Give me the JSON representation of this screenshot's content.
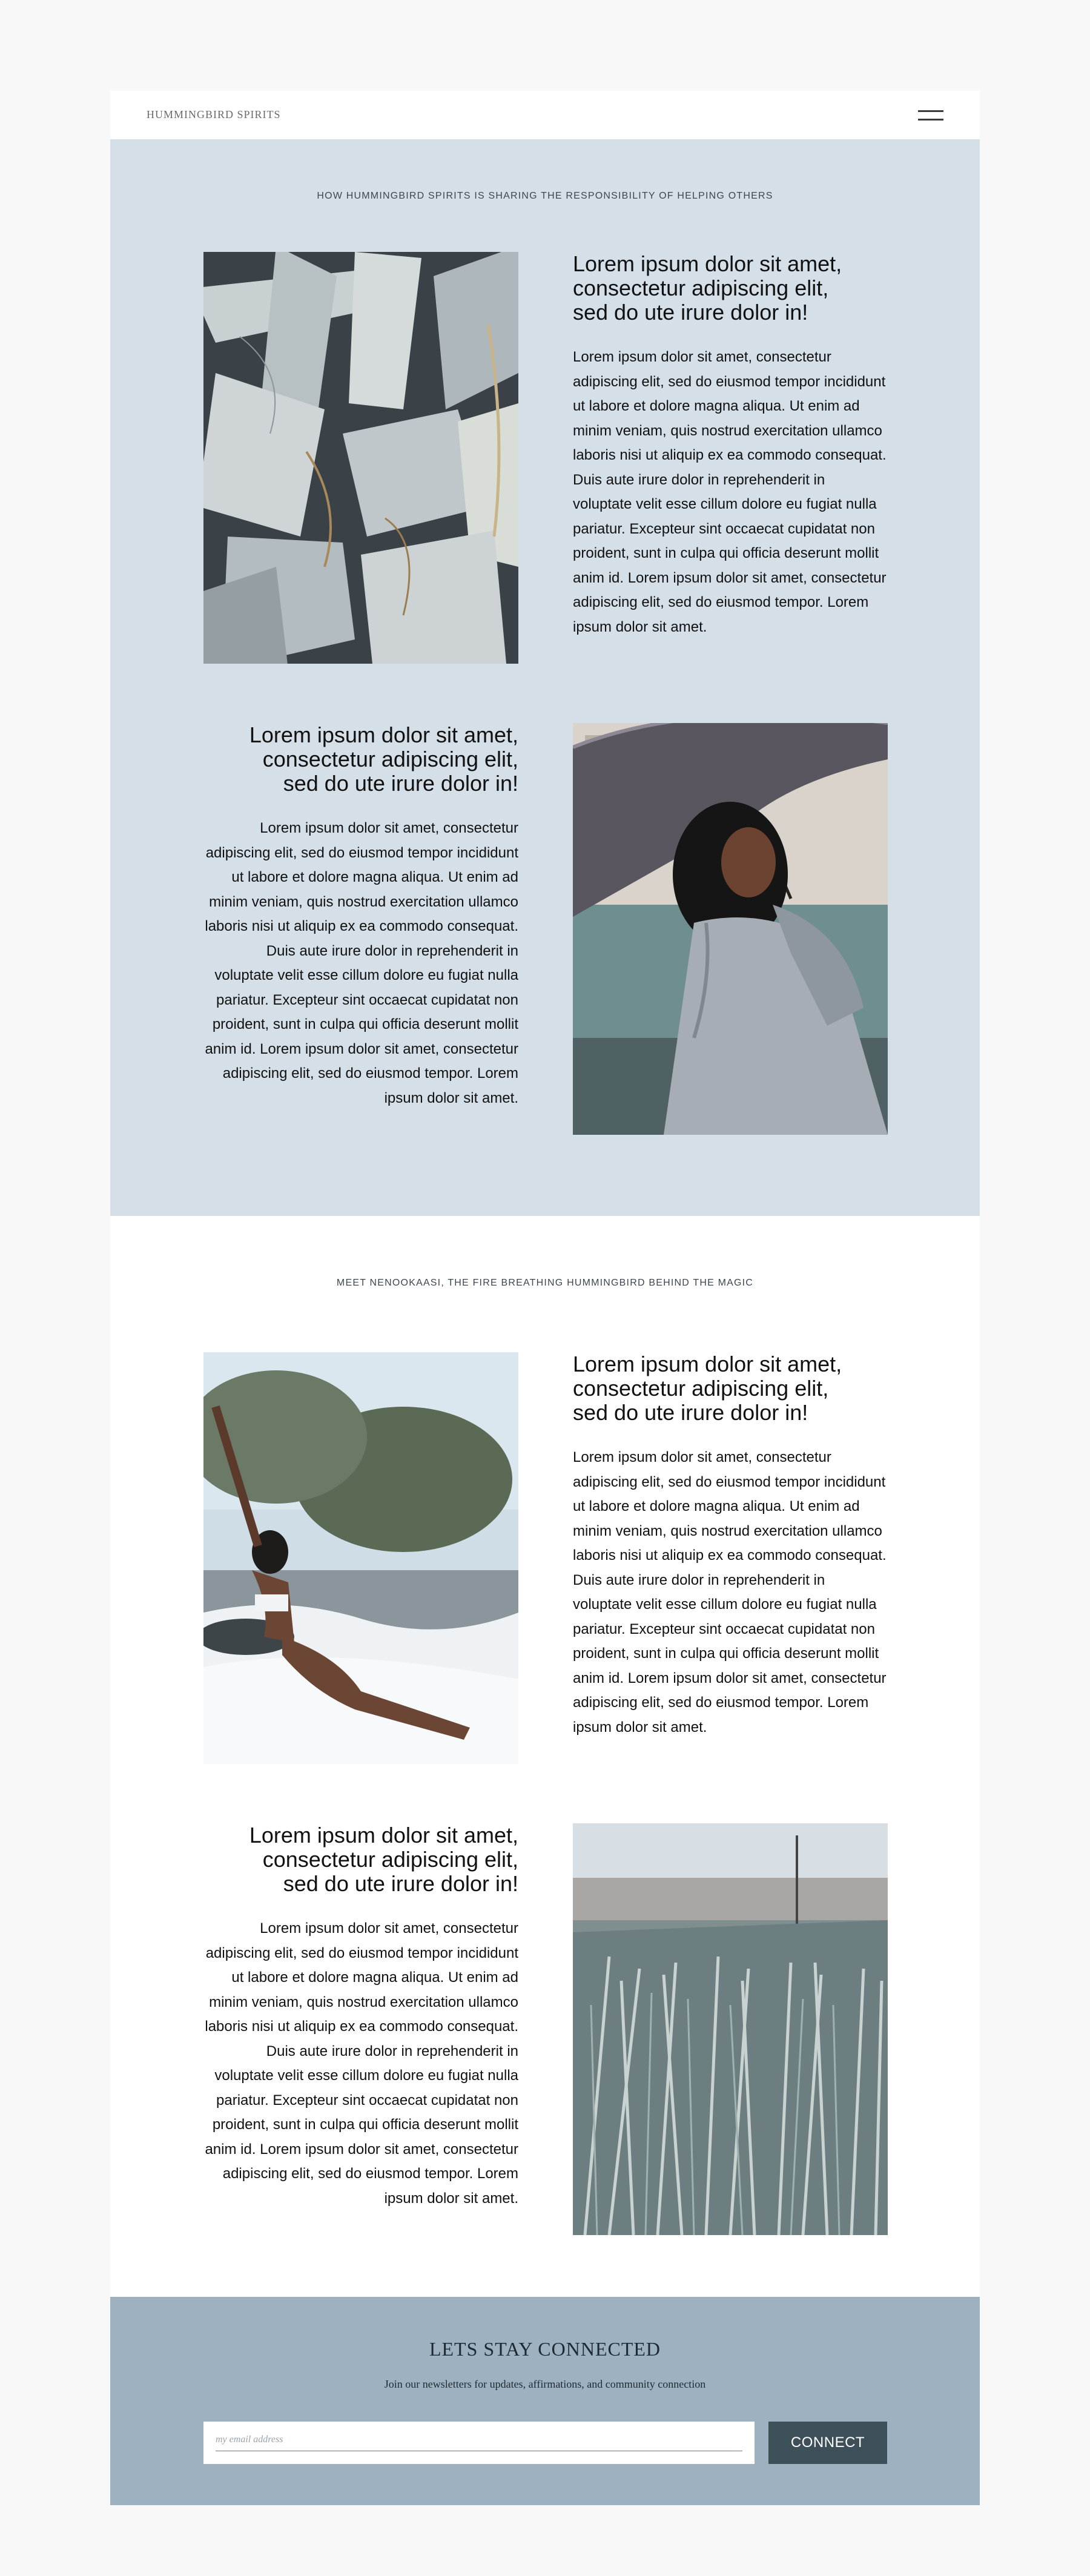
{
  "header": {
    "brand": "HUMMINGBIRD SPIRITS",
    "menu_icon": "hamburger-menu-icon"
  },
  "section1": {
    "label": "HOW HUMMINGBIRD SPIRITS IS SHARING THE RESPONSIBILITY OF HELPING OTHERS",
    "blocks": [
      {
        "title": "Lorem ipsum dolor sit amet,\nconsectetur adipiscing elit,\nsed do ute irure dolor in!",
        "body": "Lorem ipsum dolor sit amet, consectetur adipiscing elit, sed do eiusmod tempor incididunt ut labore et dolore magna aliqua. Ut enim ad minim veniam, quis nostrud exercitation ullamco laboris nisi ut aliquip ex ea commodo consequat. Duis aute irure dolor in reprehenderit in voluptate velit esse cillum dolore eu fugiat nulla pariatur. Excepteur sint occaecat cupidatat non proident, sunt in culpa qui officia deserunt mollit anim id. Lorem ipsum dolor sit amet, consectetur adipiscing elit, sed do eiusmod tempor. Lorem ipsum dolor sit amet."
      },
      {
        "title": "Lorem ipsum dolor sit amet,\nconsectetur adipiscing elit,\nsed do ute irure dolor in!",
        "body": "Lorem ipsum dolor sit amet, consectetur adipiscing elit, sed do eiusmod tempor incididunt ut labore et dolore magna aliqua. Ut enim ad minim veniam, quis nostrud exercitation ullamco laboris nisi ut aliquip ex ea commodo consequat. Duis aute irure dolor in reprehenderit in voluptate velit esse cillum dolore eu fugiat nulla pariatur. Excepteur sint occaecat cupidatat non proident, sunt in culpa qui officia deserunt mollit anim id. Lorem ipsum dolor sit amet, consectetur adipiscing elit, sed do eiusmod tempor. Lorem ipsum dolor sit amet."
      }
    ]
  },
  "section2": {
    "label": "MEET NENOOKAASI, THE FIRE BREATHING HUMMINGBIRD BEHIND THE MAGIC",
    "blocks": [
      {
        "title": "Lorem ipsum dolor sit amet,\nconsectetur adipiscing elit,\nsed do ute irure dolor in!",
        "body": "Lorem ipsum dolor sit amet, consectetur adipiscing elit, sed do eiusmod tempor incididunt ut labore et dolore magna aliqua. Ut enim ad minim veniam, quis nostrud exercitation ullamco laboris nisi ut aliquip ex ea commodo consequat. Duis aute irure dolor in reprehenderit in voluptate velit esse cillum dolore eu fugiat nulla pariatur. Excepteur sint occaecat cupidatat non proident, sunt in culpa qui officia deserunt mollit anim id. Lorem ipsum dolor sit amet, consectetur adipiscing elit, sed do eiusmod tempor. Lorem ipsum dolor sit amet."
      },
      {
        "title": "Lorem ipsum dolor sit amet,\nconsectetur adipiscing elit,\nsed do ute irure dolor in!",
        "body": "Lorem ipsum dolor sit amet, consectetur adipiscing elit, sed do eiusmod tempor incididunt ut labore et dolore magna aliqua. Ut enim ad minim veniam, quis nostrud exercitation ullamco laboris nisi ut aliquip ex ea commodo consequat. Duis aute irure dolor in reprehenderit in voluptate velit esse cillum dolore eu fugiat nulla pariatur. Excepteur sint occaecat cupidatat non proident, sunt in culpa qui officia deserunt mollit anim id. Lorem ipsum dolor sit amet, consectetur adipiscing elit, sed do eiusmod tempor. Lorem ipsum dolor sit amet."
      }
    ]
  },
  "newsletter": {
    "title": "LETS STAY CONNECTED",
    "subtitle": "Join our newsletters for updates, affirmations, and community connection",
    "email_placeholder": "my email address",
    "button_label": "CONNECT"
  },
  "colors": {
    "page_background": "#f8f8f8",
    "section_blue": "#d4dfe7",
    "newsletter_background": "#9db1c0",
    "button_background": "#3d4f58"
  }
}
